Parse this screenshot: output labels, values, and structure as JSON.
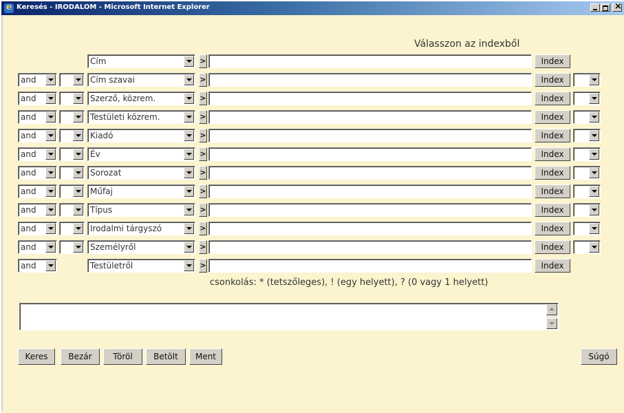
{
  "window": {
    "title": "Keresés - IRODALOM - Microsoft Internet Explorer",
    "icon": "ie-icon",
    "buttons": [
      "minimize-icon",
      "maximize-icon",
      "close-icon"
    ]
  },
  "form": {
    "index_header": "Válasszon az indexből",
    "index_button_label": "Index",
    "arrow_label": ">",
    "rows": [
      {
        "op": null,
        "field": "Cím",
        "value": "",
        "has_paren": false,
        "has_right_select": false
      },
      {
        "op": "and",
        "field": "Cím szavai",
        "value": "",
        "has_paren": true,
        "has_right_select": true
      },
      {
        "op": "and",
        "field": "Szerző, közrem.",
        "value": "",
        "has_paren": true,
        "has_right_select": true
      },
      {
        "op": "and",
        "field": "Testületi közrem.",
        "value": "",
        "has_paren": true,
        "has_right_select": true
      },
      {
        "op": "and",
        "field": "Kiadó",
        "value": "",
        "has_paren": true,
        "has_right_select": true
      },
      {
        "op": "and",
        "field": "Év",
        "value": "",
        "has_paren": true,
        "has_right_select": true
      },
      {
        "op": "and",
        "field": "Sorozat",
        "value": "",
        "has_paren": true,
        "has_right_select": true
      },
      {
        "op": "and",
        "field": "Műfaj",
        "value": "",
        "has_paren": true,
        "has_right_select": true
      },
      {
        "op": "and",
        "field": "Típus",
        "value": "",
        "has_paren": true,
        "has_right_select": true
      },
      {
        "op": "and",
        "field": "Irodalmi tárgyszó",
        "value": "",
        "has_paren": true,
        "has_right_select": true
      },
      {
        "op": "and",
        "field": "Személyről",
        "value": "",
        "has_paren": true,
        "has_right_select": true
      },
      {
        "op": "and",
        "field": "Testületről",
        "value": "",
        "has_paren": false,
        "has_right_select": false
      }
    ],
    "truncation_note": "csonkolás: * (tetszőleges), ! (egy helyett), ? (0 vagy 1 helyett)",
    "query_text": ""
  },
  "actions": {
    "keres": "Keres",
    "bezar": "Bezár",
    "torol": "Töröl",
    "betolt": "Betölt",
    "ment": "Ment",
    "sugo": "Súgó"
  },
  "colors": {
    "content_bg": "#fbf4cf",
    "chrome": "#d4d0c8",
    "titlebar": "#0a246a"
  }
}
